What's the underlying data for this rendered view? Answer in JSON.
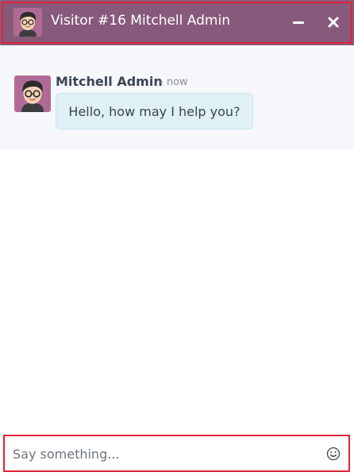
{
  "header": {
    "title": "Visitor #16 Mitchell Admin",
    "avatar_icon": "user-avatar-icon",
    "minimize_icon": "minimize-icon",
    "close_icon": "close-icon",
    "background_color": "#875a7b",
    "highlight_color": "#e02236"
  },
  "thread": {
    "messages": [
      {
        "author": "Mitchell Admin",
        "date": "- now",
        "body": "Hello, how may I help you?",
        "avatar_icon": "user-avatar-icon"
      }
    ],
    "bubble_color": "#dff1f4"
  },
  "composer": {
    "placeholder": "Say something...",
    "value": "",
    "emoji_icon": "emoji-smile-icon"
  }
}
